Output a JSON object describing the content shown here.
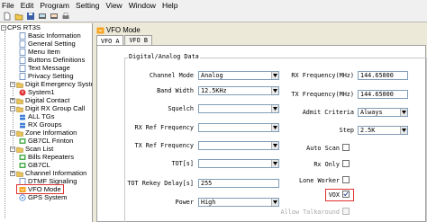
{
  "menu": [
    "File",
    "Edit",
    "Program",
    "Setting",
    "View",
    "Window",
    "Help"
  ],
  "toolbar": [
    "new-icon",
    "open-icon",
    "save-icon",
    "read-icon",
    "write-icon",
    "print-icon"
  ],
  "tree": {
    "root": "CPS RT3S",
    "items": [
      {
        "label": "Basic Information",
        "icon": "doc-icon"
      },
      {
        "label": "General Setting",
        "icon": "doc-icon"
      },
      {
        "label": "Menu Item",
        "icon": "doc-icon"
      },
      {
        "label": "Buttons Definitions",
        "icon": "doc-icon"
      },
      {
        "label": "Text Message",
        "icon": "doc-icon"
      },
      {
        "label": "Privacy Setting",
        "icon": "doc-icon"
      },
      {
        "label": "Digit Emergency Syste",
        "icon": "folder-icon"
      },
      {
        "label": "System1",
        "icon": "alert-icon"
      },
      {
        "label": "Digital Contact",
        "icon": "folder-icon"
      },
      {
        "label": "Digit RX Group Call",
        "icon": "folder-icon"
      },
      {
        "label": "ALL TGs",
        "icon": "group-icon"
      },
      {
        "label": "RX Groups",
        "icon": "group-icon"
      },
      {
        "label": "Zone Information",
        "icon": "folder-icon"
      },
      {
        "label": "GB7CL Frinton",
        "icon": "zone-icon"
      },
      {
        "label": "Scan List",
        "icon": "folder-icon"
      },
      {
        "label": "Bills Repeaters",
        "icon": "zone-icon"
      },
      {
        "label": "GB7CL",
        "icon": "zone-icon"
      },
      {
        "label": "Channel Information",
        "icon": "folder-icon"
      },
      {
        "label": "DTMF Signaling",
        "icon": "doc-icon"
      },
      {
        "label": "VFO Mode",
        "icon": "vfo-icon"
      },
      {
        "label": "GPS System",
        "icon": "gps-icon"
      }
    ]
  },
  "doc_title": "VFO Mode",
  "tabs": [
    "VFO A",
    "VFO B"
  ],
  "group_title": "Digital/Analog Data",
  "form": {
    "channel_mode_label": "Channel Mode",
    "channel_mode_value": "Analog",
    "band_width_label": "Band Width",
    "band_width_value": "12.5KHz",
    "squelch_label": "Squelch",
    "squelch_value": "",
    "rx_ref_label": "RX Ref Frequency",
    "rx_ref_value": "",
    "tx_ref_label": "TX Ref Frequency",
    "tx_ref_value": "",
    "tot_label": "TOT[s]",
    "tot_value": "",
    "tot_rekey_label": "TOT Rekey Delay[s]",
    "tot_rekey_value": "255",
    "power_label": "Power",
    "power_value": "High",
    "rx_freq_label": "RX Frequency(MHz)",
    "rx_freq_value": "144.65000",
    "tx_freq_label": "TX Frequency(MHz)",
    "tx_freq_value": "144.65000",
    "admit_label": "Admit Criteria",
    "admit_value": "Always",
    "step_label": "Step",
    "step_value": "2.5K",
    "auto_scan_label": "Auto Scan",
    "rx_only_label": "Rx Only",
    "lone_worker_label": "Lone Worker",
    "vox_label": "VOX",
    "allow_talkaround_label": "Allow Talkaround"
  },
  "colors": {
    "highlight": "#e03030",
    "field_border": "#7f9db9",
    "panel": "#ece9d8"
  }
}
